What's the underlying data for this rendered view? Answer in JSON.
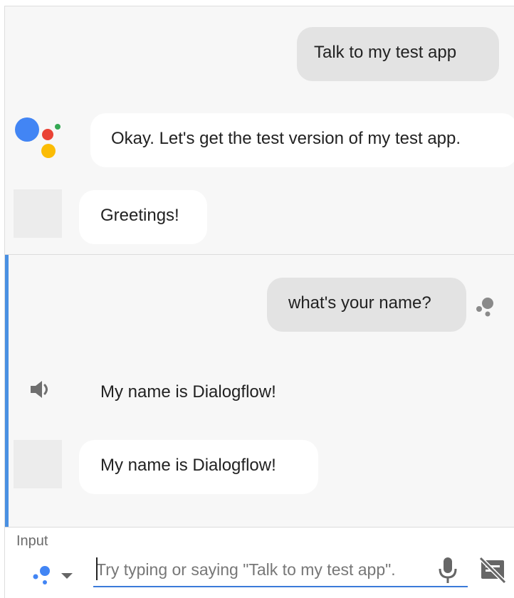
{
  "conversation": {
    "user_msg_1": "Talk to my test app",
    "assistant_msg_1": "Okay. Let's get the test version of my test app.",
    "app_msg_1": "Greetings!",
    "user_msg_2": "what's your name?",
    "spoken_response": "My name is Dialogflow!",
    "app_msg_2": "My name is Dialogflow!"
  },
  "input": {
    "label": "Input",
    "placeholder": "Try typing or saying \"Talk to my test app\"."
  },
  "icons": {
    "assistant_logo": "google-assistant-logo",
    "assistant_dots": "assistant-dots-icon",
    "speaker": "speaker-icon",
    "dropdown": "chevron-down-icon",
    "mic": "mic-icon",
    "no_display": "display-off-icon"
  },
  "colors": {
    "accent_blue": "#4a90e2",
    "google_blue": "#4285F4",
    "google_red": "#EA4335",
    "google_yellow": "#FBBC05",
    "google_green": "#34A853",
    "user_bubble": "#e3e3e3",
    "agent_bubble": "#ffffff"
  }
}
